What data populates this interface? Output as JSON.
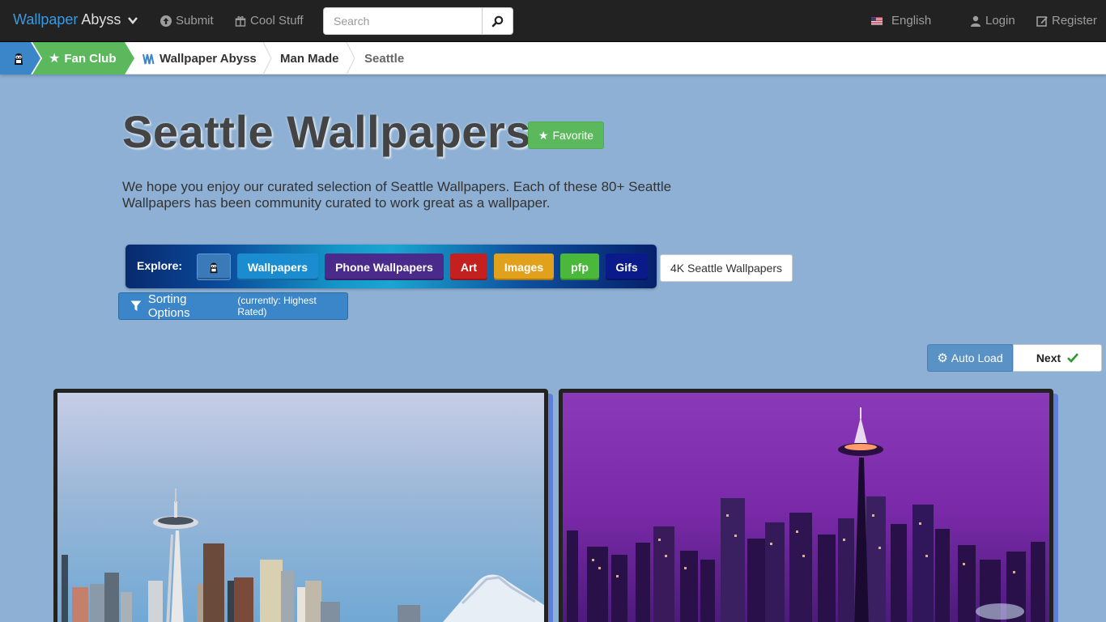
{
  "navbar": {
    "brand_part1": "Wallpaper",
    "brand_part2": " Abyss",
    "submit": "Submit",
    "cool_stuff": "Cool Stuff",
    "search_placeholder": "Search",
    "language": "English",
    "login": "Login",
    "register": "Register"
  },
  "breadcrumb": {
    "fan_club": "Fan Club",
    "site": "Wallpaper Abyss",
    "category": "Man Made",
    "current": "Seattle"
  },
  "header": {
    "title": "Seattle Wallpapers",
    "favorite": "Favorite",
    "intro": "We hope you enjoy our curated selection of Seattle Wallpapers. Each of these 80+ Seattle Wallpapers has been community curated to work great as a wallpaper."
  },
  "explore": {
    "label": "Explore:",
    "buttons": [
      {
        "label": "Wallpapers",
        "color": "#1a8ccf"
      },
      {
        "label": "Phone Wallpapers",
        "color": "#4a2a8a"
      },
      {
        "label": "Art",
        "color": "#c42020"
      },
      {
        "label": "Images",
        "color": "#e2a11c"
      },
      {
        "label": "pfp",
        "color": "#4ab83a"
      },
      {
        "label": "Gifs",
        "color": "#0a1a8a"
      }
    ],
    "k4": "4K Seattle Wallpapers"
  },
  "sorting": {
    "label": "Sorting Options",
    "current": "(currently: Highest Rated)"
  },
  "paging": {
    "auto_load": "Auto Load",
    "next": "Next"
  },
  "colors": {
    "background": "#8db0d4",
    "navbar": "#222222",
    "brand_blue": "#3a9ae0",
    "fan_green": "#5cb85c",
    "home_blue": "#3a86c8"
  },
  "thumbnails": [
    {
      "name": "seattle-day-skyline"
    },
    {
      "name": "seattle-purple-night-skyline"
    }
  ]
}
